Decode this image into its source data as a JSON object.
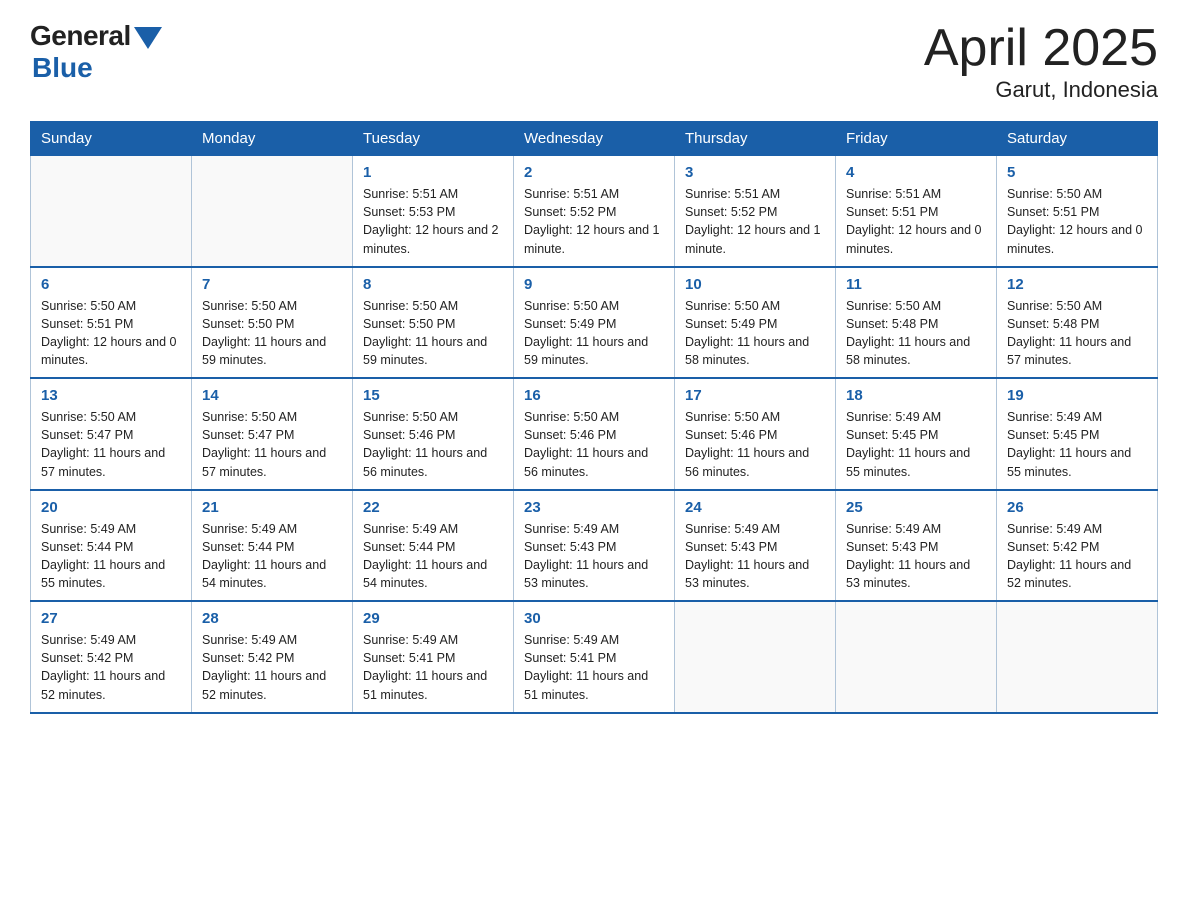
{
  "logo": {
    "general": "General",
    "blue": "Blue"
  },
  "title": "April 2025",
  "subtitle": "Garut, Indonesia",
  "days_of_week": [
    "Sunday",
    "Monday",
    "Tuesday",
    "Wednesday",
    "Thursday",
    "Friday",
    "Saturday"
  ],
  "weeks": [
    [
      {
        "day": "",
        "info": ""
      },
      {
        "day": "",
        "info": ""
      },
      {
        "day": "1",
        "info": "Sunrise: 5:51 AM\nSunset: 5:53 PM\nDaylight: 12 hours\nand 2 minutes."
      },
      {
        "day": "2",
        "info": "Sunrise: 5:51 AM\nSunset: 5:52 PM\nDaylight: 12 hours\nand 1 minute."
      },
      {
        "day": "3",
        "info": "Sunrise: 5:51 AM\nSunset: 5:52 PM\nDaylight: 12 hours\nand 1 minute."
      },
      {
        "day": "4",
        "info": "Sunrise: 5:51 AM\nSunset: 5:51 PM\nDaylight: 12 hours\nand 0 minutes."
      },
      {
        "day": "5",
        "info": "Sunrise: 5:50 AM\nSunset: 5:51 PM\nDaylight: 12 hours\nand 0 minutes."
      }
    ],
    [
      {
        "day": "6",
        "info": "Sunrise: 5:50 AM\nSunset: 5:51 PM\nDaylight: 12 hours\nand 0 minutes."
      },
      {
        "day": "7",
        "info": "Sunrise: 5:50 AM\nSunset: 5:50 PM\nDaylight: 11 hours\nand 59 minutes."
      },
      {
        "day": "8",
        "info": "Sunrise: 5:50 AM\nSunset: 5:50 PM\nDaylight: 11 hours\nand 59 minutes."
      },
      {
        "day": "9",
        "info": "Sunrise: 5:50 AM\nSunset: 5:49 PM\nDaylight: 11 hours\nand 59 minutes."
      },
      {
        "day": "10",
        "info": "Sunrise: 5:50 AM\nSunset: 5:49 PM\nDaylight: 11 hours\nand 58 minutes."
      },
      {
        "day": "11",
        "info": "Sunrise: 5:50 AM\nSunset: 5:48 PM\nDaylight: 11 hours\nand 58 minutes."
      },
      {
        "day": "12",
        "info": "Sunrise: 5:50 AM\nSunset: 5:48 PM\nDaylight: 11 hours\nand 57 minutes."
      }
    ],
    [
      {
        "day": "13",
        "info": "Sunrise: 5:50 AM\nSunset: 5:47 PM\nDaylight: 11 hours\nand 57 minutes."
      },
      {
        "day": "14",
        "info": "Sunrise: 5:50 AM\nSunset: 5:47 PM\nDaylight: 11 hours\nand 57 minutes."
      },
      {
        "day": "15",
        "info": "Sunrise: 5:50 AM\nSunset: 5:46 PM\nDaylight: 11 hours\nand 56 minutes."
      },
      {
        "day": "16",
        "info": "Sunrise: 5:50 AM\nSunset: 5:46 PM\nDaylight: 11 hours\nand 56 minutes."
      },
      {
        "day": "17",
        "info": "Sunrise: 5:50 AM\nSunset: 5:46 PM\nDaylight: 11 hours\nand 56 minutes."
      },
      {
        "day": "18",
        "info": "Sunrise: 5:49 AM\nSunset: 5:45 PM\nDaylight: 11 hours\nand 55 minutes."
      },
      {
        "day": "19",
        "info": "Sunrise: 5:49 AM\nSunset: 5:45 PM\nDaylight: 11 hours\nand 55 minutes."
      }
    ],
    [
      {
        "day": "20",
        "info": "Sunrise: 5:49 AM\nSunset: 5:44 PM\nDaylight: 11 hours\nand 55 minutes."
      },
      {
        "day": "21",
        "info": "Sunrise: 5:49 AM\nSunset: 5:44 PM\nDaylight: 11 hours\nand 54 minutes."
      },
      {
        "day": "22",
        "info": "Sunrise: 5:49 AM\nSunset: 5:44 PM\nDaylight: 11 hours\nand 54 minutes."
      },
      {
        "day": "23",
        "info": "Sunrise: 5:49 AM\nSunset: 5:43 PM\nDaylight: 11 hours\nand 53 minutes."
      },
      {
        "day": "24",
        "info": "Sunrise: 5:49 AM\nSunset: 5:43 PM\nDaylight: 11 hours\nand 53 minutes."
      },
      {
        "day": "25",
        "info": "Sunrise: 5:49 AM\nSunset: 5:43 PM\nDaylight: 11 hours\nand 53 minutes."
      },
      {
        "day": "26",
        "info": "Sunrise: 5:49 AM\nSunset: 5:42 PM\nDaylight: 11 hours\nand 52 minutes."
      }
    ],
    [
      {
        "day": "27",
        "info": "Sunrise: 5:49 AM\nSunset: 5:42 PM\nDaylight: 11 hours\nand 52 minutes."
      },
      {
        "day": "28",
        "info": "Sunrise: 5:49 AM\nSunset: 5:42 PM\nDaylight: 11 hours\nand 52 minutes."
      },
      {
        "day": "29",
        "info": "Sunrise: 5:49 AM\nSunset: 5:41 PM\nDaylight: 11 hours\nand 51 minutes."
      },
      {
        "day": "30",
        "info": "Sunrise: 5:49 AM\nSunset: 5:41 PM\nDaylight: 11 hours\nand 51 minutes."
      },
      {
        "day": "",
        "info": ""
      },
      {
        "day": "",
        "info": ""
      },
      {
        "day": "",
        "info": ""
      }
    ]
  ]
}
